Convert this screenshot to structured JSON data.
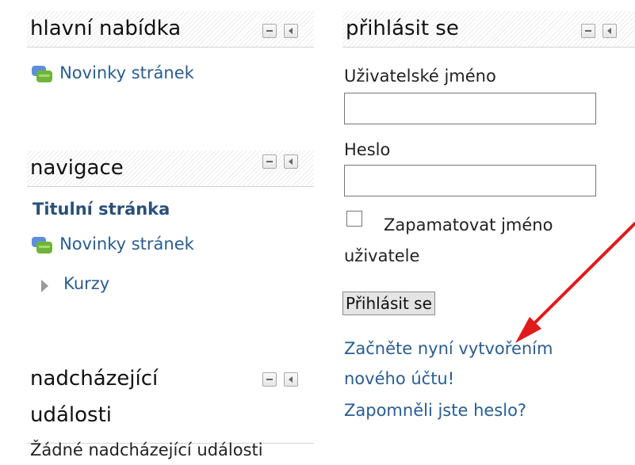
{
  "main_menu": {
    "title": "hlavní nabídka",
    "items": [
      {
        "label": "Novinky stránek",
        "icon": "forum-chat-icon"
      }
    ]
  },
  "navigation": {
    "title": "navigace",
    "home_link": "Titulní stránka",
    "items": [
      {
        "label": "Novinky stránek",
        "icon": "forum-chat-icon"
      },
      {
        "label": "Kurzy",
        "icon": "expand-triangle-icon"
      }
    ]
  },
  "upcoming_events": {
    "title_line1": "nadcházející",
    "title_line2": "události",
    "empty_text": "Žádné nadcházející události"
  },
  "login": {
    "title": "přihlásit se",
    "username_label": "Uživatelské jméno",
    "username_value": "",
    "password_label": "Heslo",
    "password_value": "",
    "remember_label_line1": "Zapamatovat jméno",
    "remember_label_line2": "uživatele",
    "remember_checked": false,
    "submit_label": "Přihlásit se",
    "signup_line1": "Začněte nyní vytvořením",
    "signup_line2": "nového účtu!",
    "forgot_password": "Zapomněli jste heslo?"
  },
  "block_controls": {
    "hide_icon": "minus-box-icon",
    "dock_icon": "dock-left-icon"
  },
  "annotation": {
    "arrow_color": "#e01b1b"
  },
  "colors": {
    "link": "#2a5d8f"
  }
}
